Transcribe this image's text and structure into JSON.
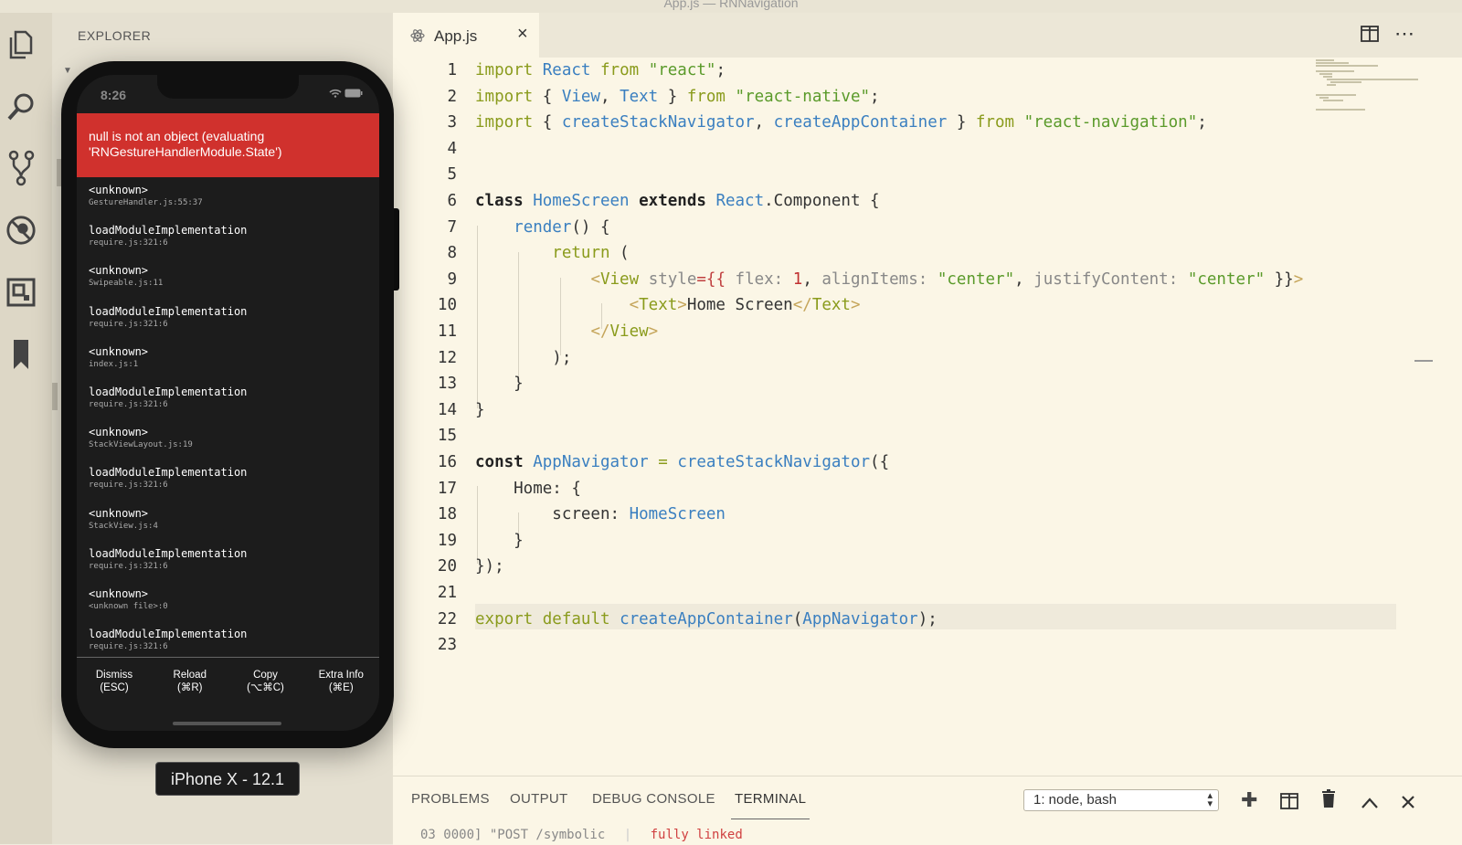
{
  "window": {
    "title": "App.js — RNNavigation"
  },
  "activity_bar": {
    "icons": [
      "files-icon",
      "search-icon",
      "source-control-icon",
      "debug-icon",
      "extensions-icon",
      "bookmark-icon"
    ]
  },
  "sidebar": {
    "header": "EXPLORER"
  },
  "editor": {
    "tab": {
      "label": "App.js",
      "close": "×"
    },
    "line_numbers": [
      "1",
      "2",
      "3",
      "4",
      "5",
      "6",
      "7",
      "8",
      "9",
      "10",
      "11",
      "12",
      "13",
      "14",
      "15",
      "16",
      "17",
      "18",
      "19",
      "20",
      "21",
      "22",
      "23"
    ],
    "current_line": 22
  },
  "panel": {
    "tabs": [
      "PROBLEMS",
      "OUTPUT",
      "DEBUG CONSOLE",
      "TERMINAL"
    ],
    "active_tab": "TERMINAL",
    "terminal_select": "1: node, bash",
    "terminal_preview_left": "03  0000] \"POST /symbolic",
    "terminal_preview_right": "fully linked"
  },
  "simulator": {
    "device_label": "iPhone X - 12.1",
    "status_time": "8:26",
    "error_message": "null is not an object (evaluating 'RNGestureHandlerModule.State')",
    "stack": [
      {
        "fn": "<unknown>",
        "loc": "GestureHandler.js:55:37"
      },
      {
        "fn": "loadModuleImplementation",
        "loc": "require.js:321:6"
      },
      {
        "fn": "<unknown>",
        "loc": "Swipeable.js:11"
      },
      {
        "fn": "loadModuleImplementation",
        "loc": "require.js:321:6"
      },
      {
        "fn": "<unknown>",
        "loc": "index.js:1"
      },
      {
        "fn": "loadModuleImplementation",
        "loc": "require.js:321:6"
      },
      {
        "fn": "<unknown>",
        "loc": "StackViewLayout.js:19"
      },
      {
        "fn": "loadModuleImplementation",
        "loc": "require.js:321:6"
      },
      {
        "fn": "<unknown>",
        "loc": "StackView.js:4"
      },
      {
        "fn": "loadModuleImplementation",
        "loc": "require.js:321:6"
      },
      {
        "fn": "<unknown>",
        "loc": "<unknown file>:0"
      },
      {
        "fn": "loadModuleImplementation",
        "loc": "require.js:321:6"
      }
    ],
    "actions": [
      {
        "label": "Dismiss",
        "shortcut": "(ESC)"
      },
      {
        "label": "Reload",
        "shortcut": "(⌘R)"
      },
      {
        "label": "Copy",
        "shortcut": "(⌥⌘C)"
      },
      {
        "label": "Extra Info",
        "shortcut": "(⌘E)"
      }
    ]
  }
}
